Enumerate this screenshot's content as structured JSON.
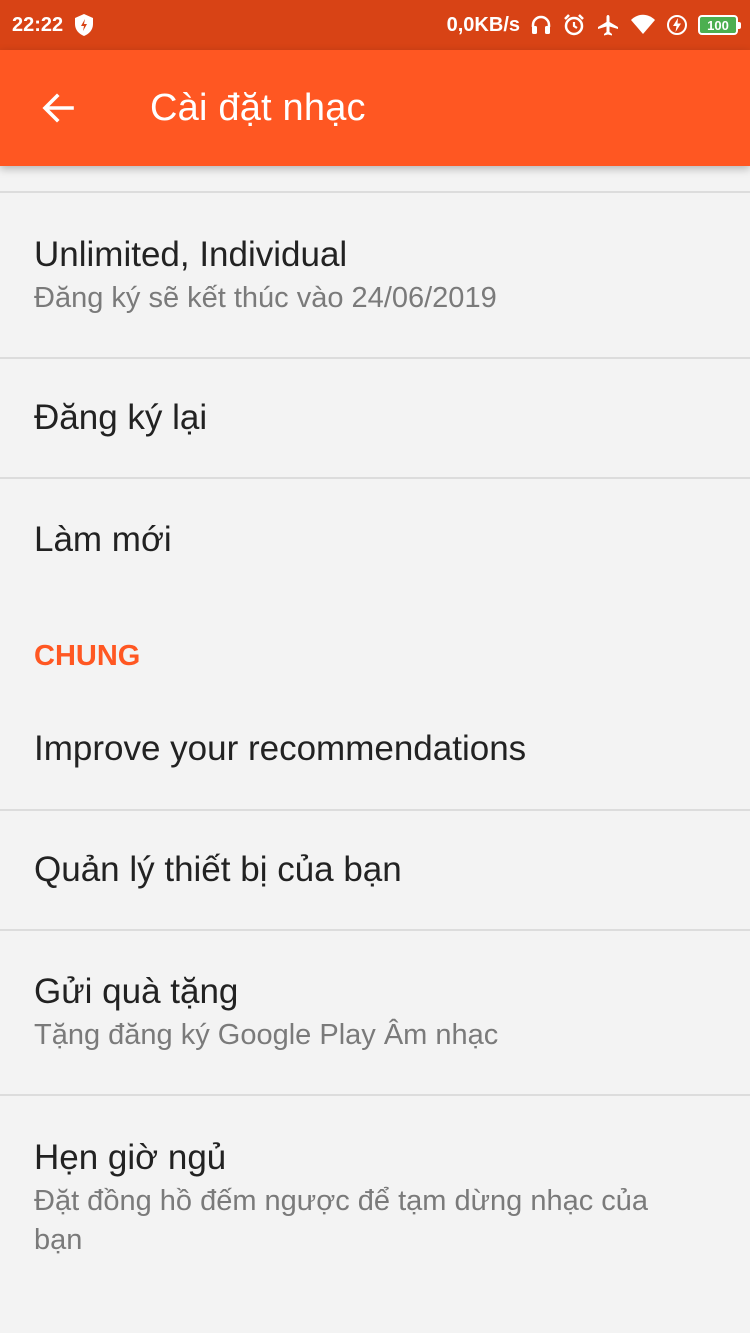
{
  "status_bar": {
    "time": "22:22",
    "network_speed": "0,0KB/s",
    "battery": "100",
    "icons": [
      "shield-icon",
      "headphones-icon",
      "alarm-icon",
      "airplane-icon",
      "wifi-icon",
      "charging-icon",
      "battery-icon"
    ]
  },
  "app_bar": {
    "title": "Cài đặt nhạc",
    "back_icon": "arrow-back-icon",
    "color": "#ff5722",
    "status_color": "#d84315"
  },
  "subscription": {
    "title": "Unlimited, Individual",
    "subtitle": "Đăng ký sẽ kết thúc vào 24/06/2019"
  },
  "resubscribe": {
    "title": "Đăng ký lại"
  },
  "refresh": {
    "title": "Làm mới"
  },
  "general_section": {
    "header": "CHUNG",
    "items": [
      {
        "title": "Improve your recommendations"
      },
      {
        "title": "Quản lý thiết bị của bạn"
      },
      {
        "title": "Gửi quà tặng",
        "subtitle": "Tặng đăng ký Google Play Âm nhạc"
      },
      {
        "title": "Hẹn giờ ngủ",
        "subtitle": "Đặt đồng hồ đếm ngược để tạm dừng nhạc của bạn"
      }
    ]
  },
  "accent_color": "#ff5722"
}
